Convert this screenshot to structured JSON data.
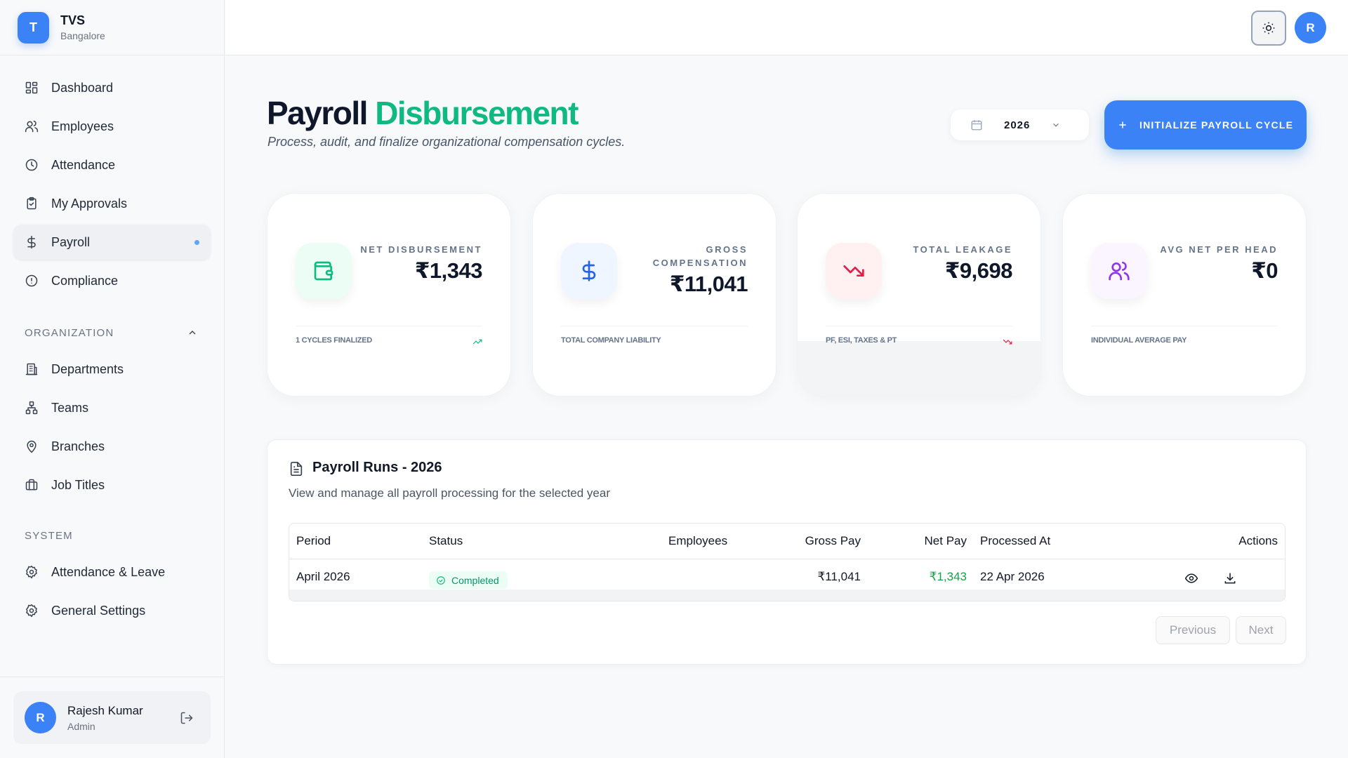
{
  "brand": {
    "initial": "T",
    "name": "TVS",
    "location": "Bangalore"
  },
  "nav": {
    "main": [
      {
        "label": "Dashboard",
        "icon": "dashboard-icon"
      },
      {
        "label": "Employees",
        "icon": "users-icon"
      },
      {
        "label": "Attendance",
        "icon": "clock-icon"
      },
      {
        "label": "My Approvals",
        "icon": "clipboard-check-icon"
      },
      {
        "label": "Payroll",
        "icon": "dollar-icon",
        "active": true
      },
      {
        "label": "Compliance",
        "icon": "alert-circle-icon"
      }
    ],
    "organization_label": "ORGANIZATION",
    "organization": [
      {
        "label": "Departments",
        "icon": "building-icon"
      },
      {
        "label": "Teams",
        "icon": "network-icon"
      },
      {
        "label": "Branches",
        "icon": "map-pin-icon"
      },
      {
        "label": "Job Titles",
        "icon": "briefcase-icon"
      }
    ],
    "system_label": "SYSTEM",
    "system": [
      {
        "label": "Attendance & Leave",
        "icon": "gear-icon"
      },
      {
        "label": "General Settings",
        "icon": "gear-icon"
      }
    ]
  },
  "user": {
    "initial": "R",
    "name": "Rajesh Kumar",
    "role": "Admin"
  },
  "topbar": {
    "avatar_initial": "R",
    "theme_icon": "sun-icon"
  },
  "header": {
    "title_part1": "Payroll",
    "title_part2": "Disbursement",
    "subtitle": "Process, audit, and finalize organizational compensation cycles.",
    "year": "2026",
    "init_button": "INITIALIZE PAYROLL CYCLE"
  },
  "stats": [
    {
      "label": "NET DISBURSEMENT",
      "value": "₹1,343",
      "footer": "1 CYCLES FINALIZED",
      "icon": "wallet-icon",
      "color": "#10b981"
    },
    {
      "label": "GROSS COMPENSATION",
      "value": "₹11,041",
      "footer": "TOTAL COMPANY LIABILITY",
      "icon": "dollar-icon",
      "color": "#2563eb"
    },
    {
      "label": "TOTAL LEAKAGE",
      "value": "₹9,698",
      "footer": "PF, ESI, TAXES & PT",
      "icon": "trending-down-icon",
      "color": "#e11d48"
    },
    {
      "label": "AVG NET PER HEAD",
      "value": "₹0",
      "footer": "INDIVIDUAL AVERAGE PAY",
      "icon": "users-icon",
      "color": "#9333ea"
    }
  ],
  "runs": {
    "title": "Payroll Runs - 2026",
    "subtitle": "View and manage all payroll processing for the selected year",
    "columns": [
      "Period",
      "Status",
      "Employees",
      "Gross Pay",
      "Net Pay",
      "Processed At",
      "Actions"
    ],
    "rows": [
      {
        "period": "April 2026",
        "status": "Completed",
        "employees": "",
        "gross": "₹11,041",
        "net": "₹1,343",
        "processed": "22 Apr 2026"
      }
    ],
    "prev_label": "Previous",
    "next_label": "Next"
  }
}
